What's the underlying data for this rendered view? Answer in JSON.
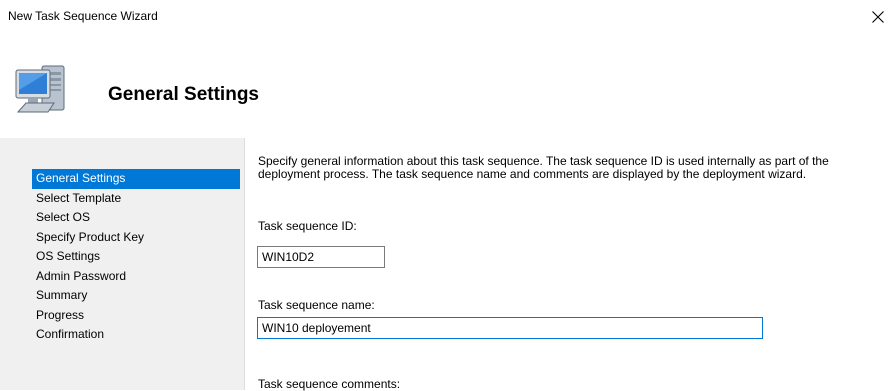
{
  "window": {
    "title": "New Task Sequence Wizard",
    "close_icon": "close-icon"
  },
  "header": {
    "title": "General Settings",
    "icon": "computer-icon"
  },
  "sidebar": {
    "items": [
      {
        "label": "General Settings",
        "active": true
      },
      {
        "label": "Select Template"
      },
      {
        "label": "Select OS"
      },
      {
        "label": "Specify Product Key"
      },
      {
        "label": "OS Settings"
      },
      {
        "label": "Admin Password"
      },
      {
        "label": "Summary"
      },
      {
        "label": "Progress"
      },
      {
        "label": "Confirmation"
      }
    ]
  },
  "main": {
    "description_line1": "Specify general information about this task sequence.  The task sequence ID is used internally as part of the",
    "description_line2": "deployment process.  The task sequence name and comments are displayed by the deployment wizard.",
    "task_id_label": "Task sequence ID:",
    "task_id_value": "WIN10D2",
    "task_name_label": "Task sequence name:",
    "task_name_value": "WIN10 deployement",
    "comments_label": "Task sequence comments:"
  },
  "colors": {
    "selection": "#0078d7",
    "sidebar_bg": "#f0f0f0"
  }
}
